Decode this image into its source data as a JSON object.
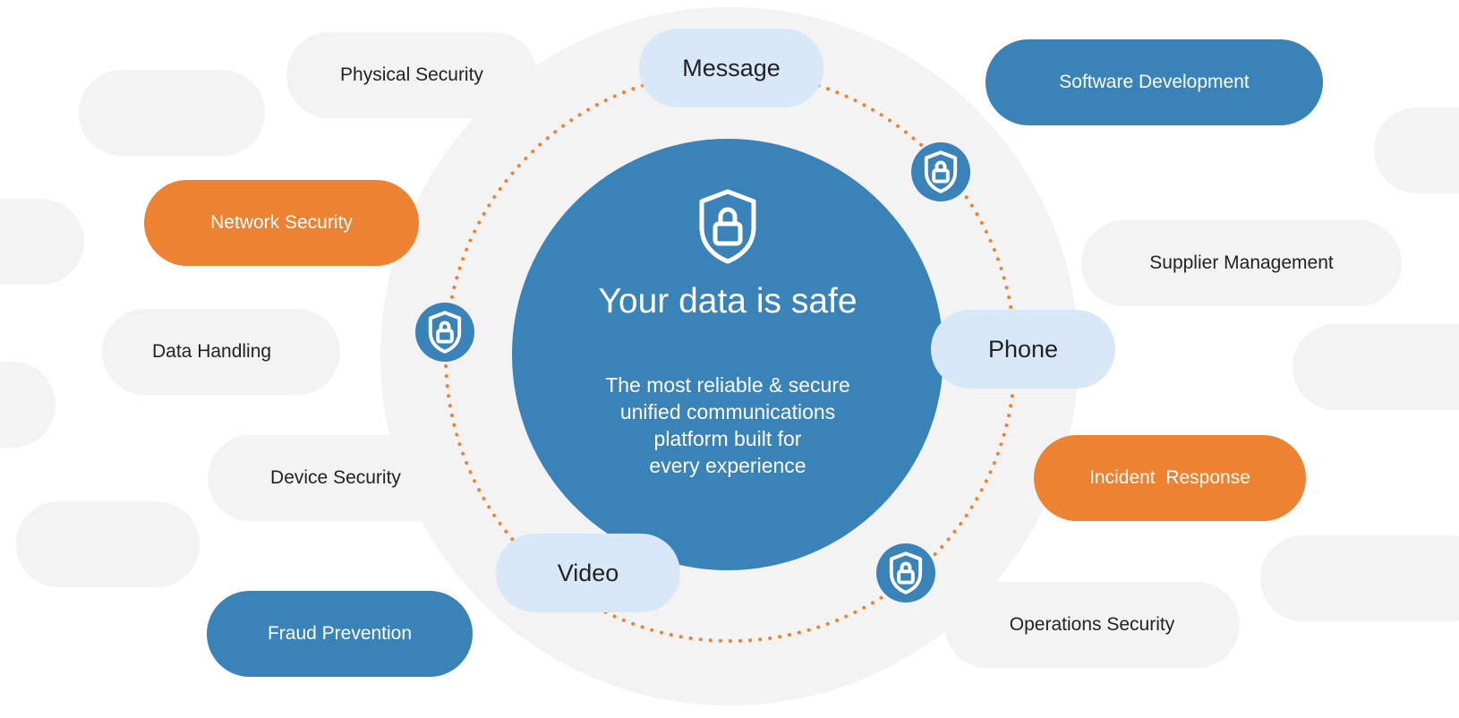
{
  "diagram": {
    "center": {
      "icon": "shield-lock-icon",
      "title": "Your data is safe",
      "subtitle_lines": [
        "The most reliable & secure",
        "unified communications",
        "platform built for",
        "every experience"
      ]
    },
    "orbit_nodes": {
      "message": "Message",
      "phone": "Phone",
      "video": "Video"
    },
    "orbit_badges": [
      {
        "icon": "shield-lock-icon"
      },
      {
        "icon": "shield-lock-icon"
      },
      {
        "icon": "shield-lock-icon"
      }
    ],
    "topics": {
      "physical_security": "Physical Security",
      "network_security": "Network Security",
      "data_handling": "Data Handling",
      "device_security": "Device Security",
      "fraud_prevention": "Fraud Prevention",
      "software_development": "Software Development",
      "supplier_management": "Supplier Management",
      "incident_response": "Incident  Response",
      "operations_security": "Operations Security"
    },
    "colors": {
      "blue": "#3a83b8",
      "orange": "#ee8233",
      "light_blue": "#d8e8f8",
      "gray": "#f3f3f3",
      "dots": "#ee8233"
    }
  }
}
